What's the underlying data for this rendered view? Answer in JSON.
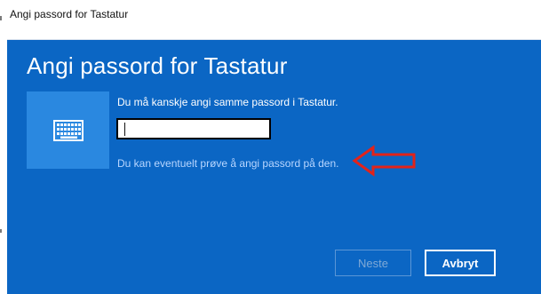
{
  "window": {
    "title": "Angi passord for Tastatur"
  },
  "dialog": {
    "heading": "Angi passord for Tastatur",
    "icon": "keyboard-icon",
    "prompt": "Du må kanskje angi samme passord i Tastatur.",
    "password_value": "",
    "hint": "Du kan eventuelt prøve å angi passord på den.",
    "annotation_icon": "red-arrow-icon"
  },
  "buttons": {
    "next_label": "Neste",
    "cancel_label": "Avbryt"
  },
  "colors": {
    "panel_bg": "#0b66c4",
    "icon_tile": "#2a88e0",
    "hint_text": "#b8d6ff",
    "annotation_red": "#e2231a"
  }
}
